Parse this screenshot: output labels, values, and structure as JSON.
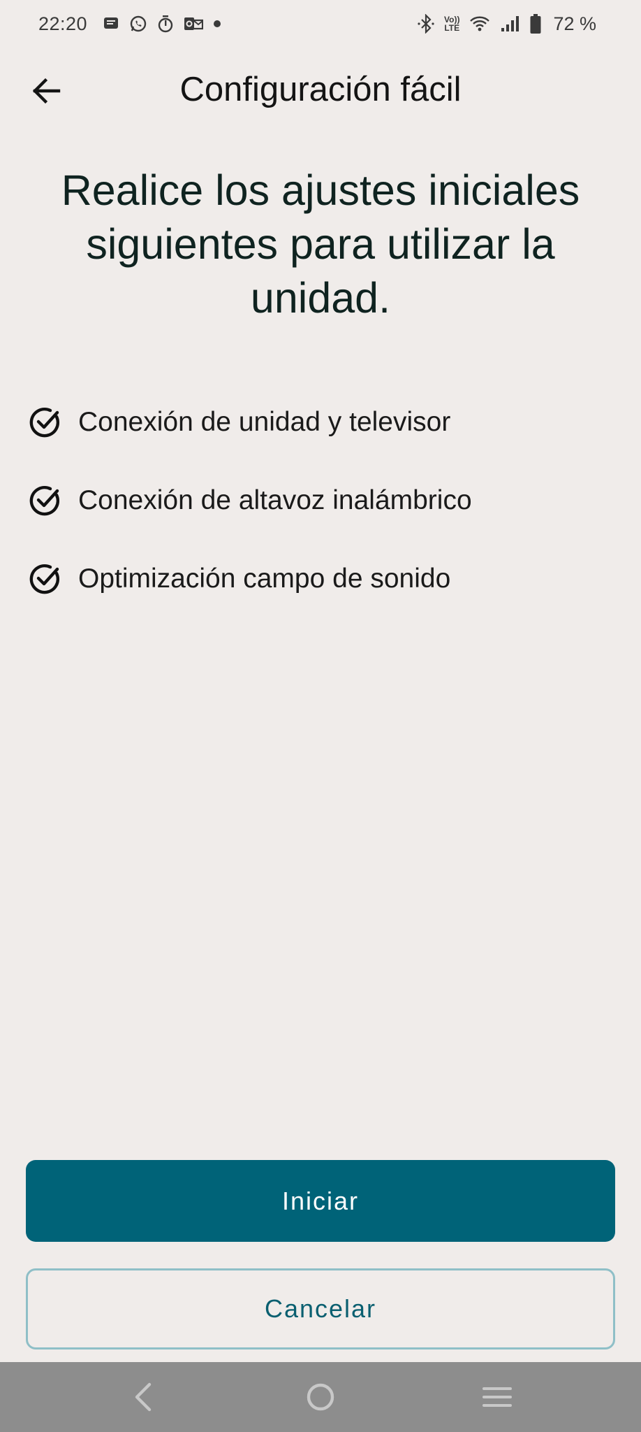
{
  "status_bar": {
    "time": "22:20",
    "battery_text": "72 %",
    "left_icons": [
      "message-icon",
      "whatsapp-icon",
      "timer-icon",
      "outlook-icon",
      "dot-icon"
    ],
    "right_icons": [
      "bluetooth-icon",
      "volte-icon",
      "wifi-icon",
      "signal-icon",
      "battery-icon"
    ],
    "volte_label_top": "Vo))",
    "volte_label_bottom": "LTE"
  },
  "header": {
    "back_icon": "arrow-left-icon",
    "title": "Configuración fácil"
  },
  "headline": "Realice los ajustes iniciales siguientes para utilizar la unidad.",
  "checklist": {
    "icon": "check-circle-icon",
    "items": [
      "Conexión de unidad y televisor",
      "Conexión de altavoz inalámbrico",
      "Optimización campo de sonido"
    ]
  },
  "buttons": {
    "primary_label": "Iniciar",
    "secondary_label": "Cancelar"
  },
  "nav_bar": {
    "icons": [
      "nav-back-icon",
      "nav-home-icon",
      "nav-recents-icon"
    ]
  },
  "colors": {
    "background": "#f0ecea",
    "primary": "#006378",
    "secondary_border": "#8fbfc7",
    "secondary_text": "#0a5f70",
    "nav_bar": "#8d8d8d"
  }
}
